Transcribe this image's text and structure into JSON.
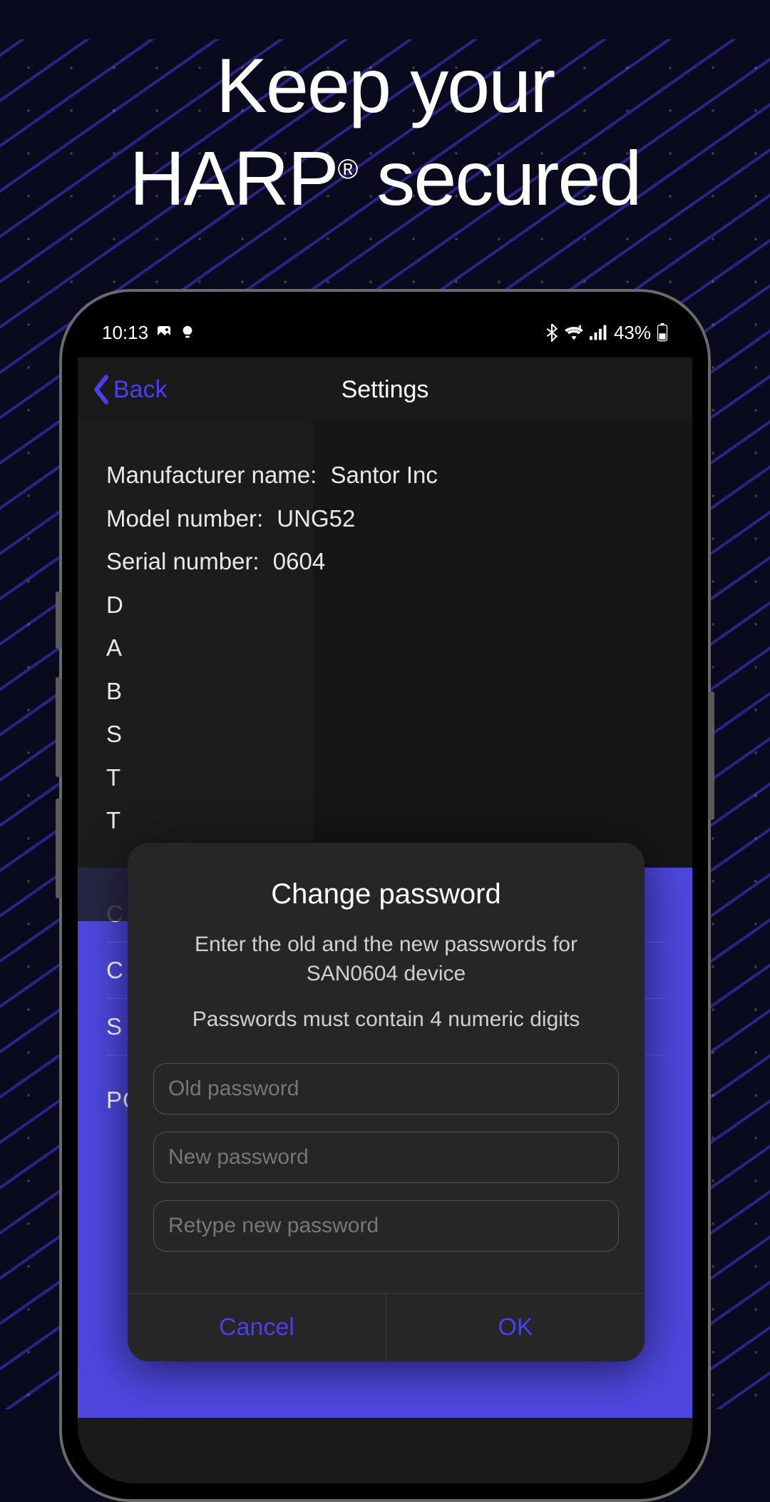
{
  "promo": {
    "headline_l1": "Keep your",
    "headline_l2a": "HARP",
    "headline_l2b": " secured",
    "reg": "®"
  },
  "status": {
    "time": "10:13",
    "battery_pct": "43%"
  },
  "nav": {
    "back_label": "Back",
    "title": "Settings"
  },
  "info": {
    "mfr_label": "Manufacturer name:",
    "mfr_value": "Santor Inc",
    "model_label": "Model number:",
    "model_value": "UNG52",
    "serial_label": "Serial number:",
    "serial_value": "0604",
    "partial_D": "D",
    "partial_A": "A",
    "partial_B": "B",
    "partial_S": "S",
    "partial_T1": "T",
    "partial_T2": "T"
  },
  "menu": {
    "c1": "C",
    "c2": "C",
    "s": "S",
    "power_heading": "POWER ACTIVATION"
  },
  "dialog": {
    "title": "Change password",
    "line1": "Enter the old and the new passwords for SAN0604 device",
    "line2": "Passwords must contain 4 numeric digits",
    "old_ph": "Old password",
    "new_ph": "New password",
    "retype_ph": "Retype new password",
    "cancel": "Cancel",
    "ok": "OK"
  }
}
